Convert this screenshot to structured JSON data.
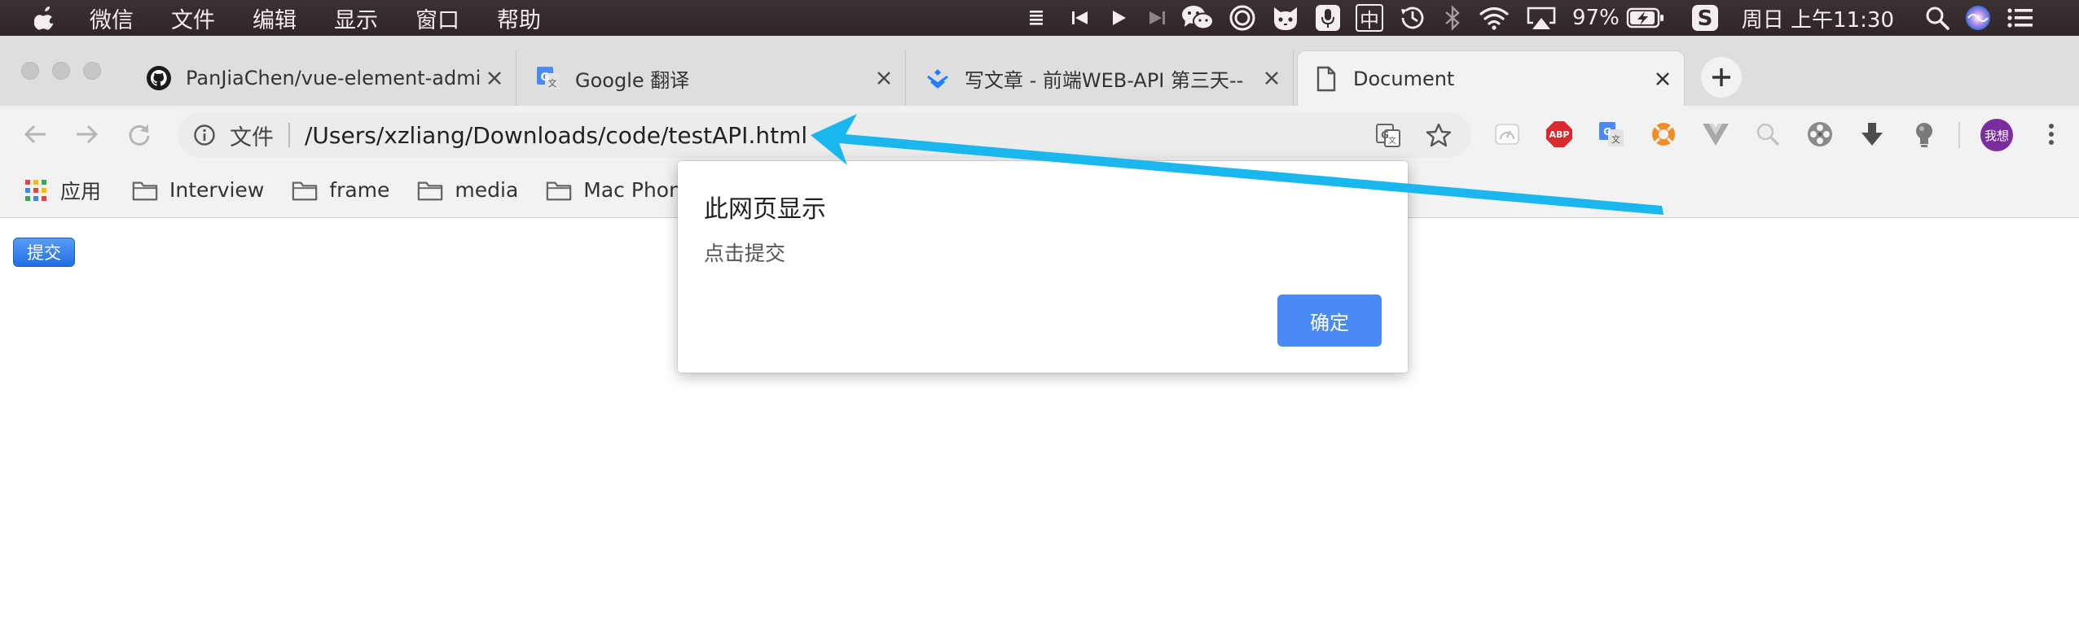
{
  "menubar": {
    "items": [
      "微信",
      "文件",
      "编辑",
      "显示",
      "窗口",
      "帮助"
    ],
    "ime_label": "中",
    "battery": "97%",
    "clock": "周日 上午11:30"
  },
  "tabs": [
    {
      "title": "PanJiaChen/vue-element-admi",
      "favicon": "github-icon"
    },
    {
      "title": "Google 翻译",
      "favicon": "google-translate-icon"
    },
    {
      "title": "写文章 - 前端WEB-API 第三天--",
      "favicon": "juejin-icon"
    },
    {
      "title": "Document",
      "favicon": "document-icon"
    }
  ],
  "omnibox": {
    "scheme_label": "文件",
    "url": "/Users/xzliang/Downloads/code/testAPI.html"
  },
  "extensions": {
    "adblock_label": "ABP",
    "avatar_label": "我想"
  },
  "bookmarks": [
    {
      "label": "应用",
      "icon": "apps-grid-icon"
    },
    {
      "label": "Interview",
      "icon": "folder-icon"
    },
    {
      "label": "frame",
      "icon": "folder-icon"
    },
    {
      "label": "media",
      "icon": "folder-icon"
    },
    {
      "label": "Mac Phone",
      "icon": "folder-icon"
    }
  ],
  "page": {
    "submit_label": "提交"
  },
  "alert": {
    "title": "此网页显示",
    "message": "点击提交",
    "ok_label": "确定"
  },
  "colors": {
    "menubar": "#332a2d",
    "accent_blue": "#4a8af4",
    "annotation_arrow": "#1ab7ee"
  }
}
